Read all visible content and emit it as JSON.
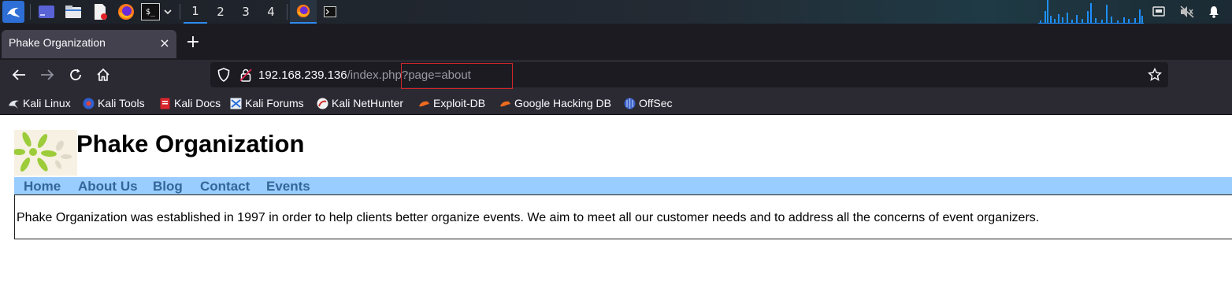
{
  "taskbar": {
    "workspaces": [
      "1",
      "2",
      "3",
      "4"
    ],
    "active_workspace": "1",
    "terminal_prompt": "$_",
    "accent": "#2d8cf0"
  },
  "browser": {
    "tab_title": "Phake Organization",
    "tab_close": "×",
    "new_tab": "+",
    "url_host": "192.168.239.136",
    "url_path": "/index.php?page=about",
    "bookmarks": [
      {
        "label": "Kali Linux",
        "icon": "kali-dragon-icon"
      },
      {
        "label": "Kali Tools",
        "icon": "kali-tools-icon"
      },
      {
        "label": "Kali Docs",
        "icon": "kali-docs-icon"
      },
      {
        "label": "Kali Forums",
        "icon": "kali-forums-icon"
      },
      {
        "label": "Kali NetHunter",
        "icon": "nethunter-icon"
      },
      {
        "label": "Exploit-DB",
        "icon": "exploit-db-icon"
      },
      {
        "label": "Google Hacking DB",
        "icon": "ghdb-icon"
      },
      {
        "label": "OffSec",
        "icon": "offsec-icon"
      }
    ]
  },
  "site": {
    "title": "Phake Organization",
    "nav": [
      "Home",
      "About Us",
      "Blog",
      "Contact",
      "Events"
    ],
    "content": "Phake Organization was established in 1997 in order to help clients better organize events. We aim to meet all our customer needs and to address all the concerns of event organizers.",
    "nav_bg": "#99ccff",
    "nav_link_color": "#336699"
  }
}
